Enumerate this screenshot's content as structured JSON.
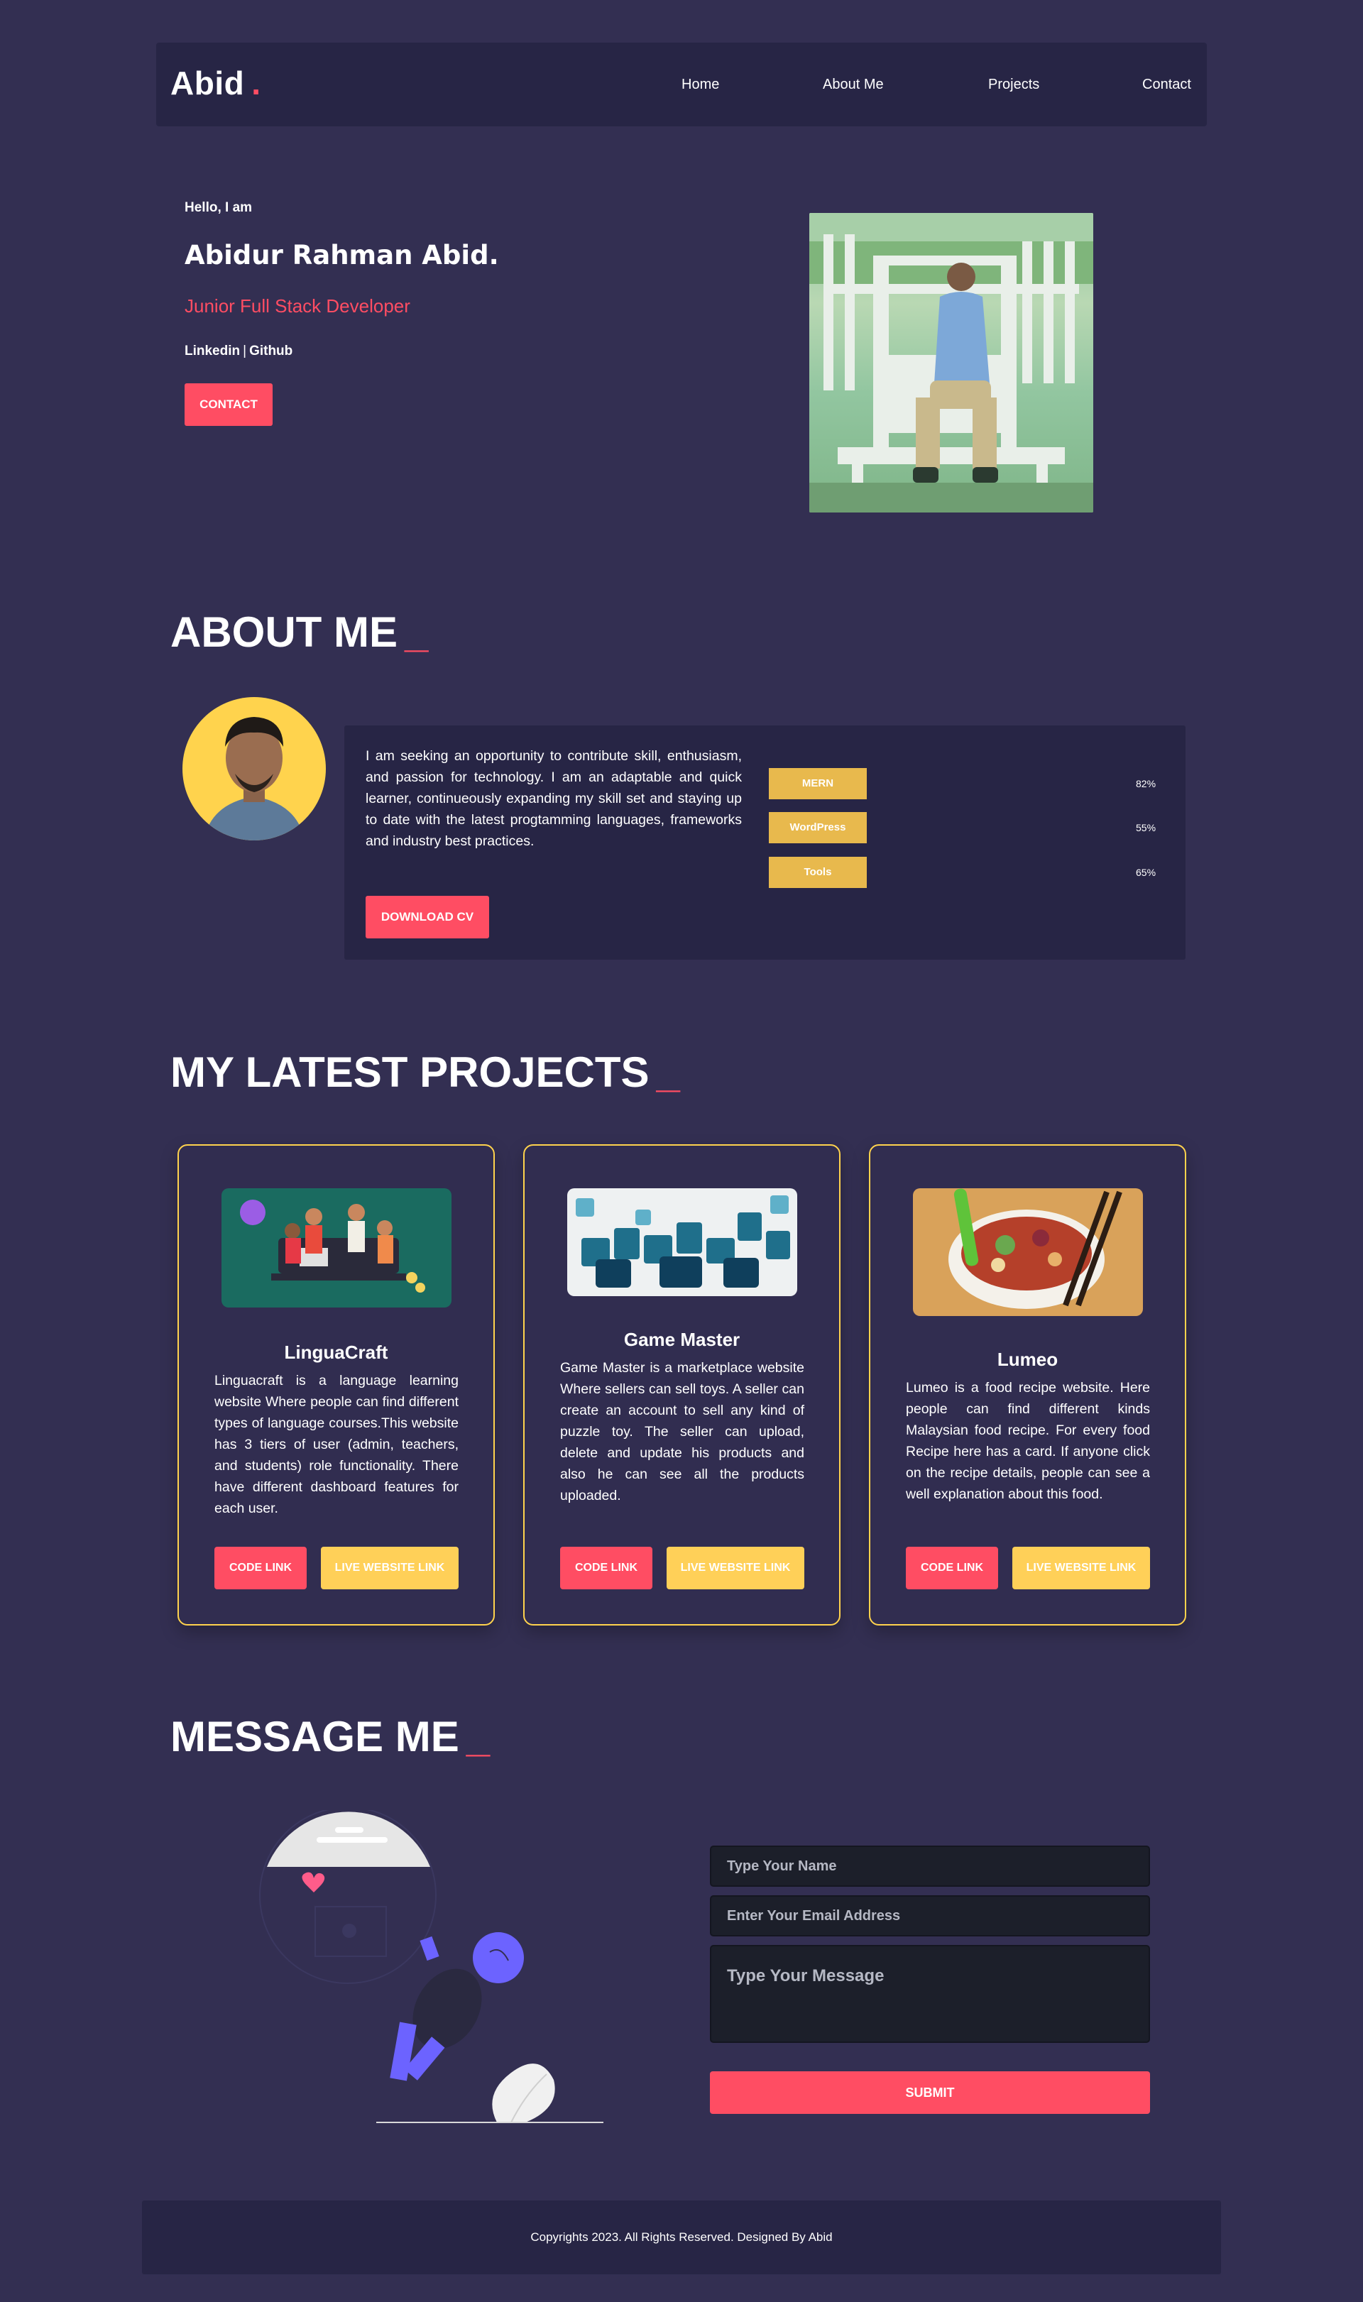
{
  "nav": {
    "logo": "Abid",
    "logo_dot": ".",
    "links": [
      "Home",
      "About Me",
      "Projects",
      "Contact"
    ]
  },
  "hero": {
    "greeting": "Hello, I am",
    "name": "Abidur Rahman Abid.",
    "role": "Junior Full Stack Developer",
    "linkedin": "Linkedin",
    "separator": "|",
    "github": "Github",
    "contact_button": "CONTACT"
  },
  "about": {
    "title": "ABOUT ME",
    "title_mark": "_",
    "text": "I am seeking an opportunity to contribute skill, enthusiasm, and passion for technology. I am an adaptable and quick learner, continueously expanding my skill set and staying up to date with the latest progtamming languages, frameworks and industry best practices.",
    "cv_button": "DOWNLOAD CV",
    "skills": [
      {
        "label": "MERN",
        "percent": "82%"
      },
      {
        "label": "WordPress",
        "percent": "55%"
      },
      {
        "label": "Tools",
        "percent": "65%"
      }
    ]
  },
  "projects": {
    "title": "MY LATEST PROJECTS",
    "title_mark": "_",
    "items": [
      {
        "title": "LinguaCraft",
        "description": "Linguacraft is a language learning website Where people can find different types of language courses.This website has 3 tiers of user (admin, teachers, and students) role functionality. There have different dashboard features for each user.",
        "code_button": "CODE LINK",
        "live_button": "LIVE WEBSITE LINK"
      },
      {
        "title": "Game Master",
        "description": "Game Master is a marketplace website Where sellers can sell toys. A seller can create an account to sell any kind of puzzle toy. The seller can upload, delete and update his products and also he can see all the products uploaded.",
        "code_button": "CODE LINK",
        "live_button": "LIVE WEBSITE LINK"
      },
      {
        "title": "Lumeo",
        "description": "Lumeo is a food recipe website. Here people can find different kinds Malaysian food recipe. For every food Recipe here has a card. If anyone click on the recipe details, people can see a well explanation about this food.",
        "code_button": "CODE LINK",
        "live_button": "LIVE WEBSITE LINK"
      }
    ]
  },
  "message": {
    "title": "MESSAGE ME",
    "title_mark": "_",
    "name_placeholder": "Type Your Name",
    "email_placeholder": "Enter Your Email Address",
    "message_placeholder": "Type Your Message",
    "submit_button": "SUBMIT"
  },
  "footer": {
    "text": "Copyrights 2023. All Rights Reserved. Designed By Abid"
  },
  "colors": {
    "background": "#332f52",
    "panel": "#272545",
    "accent_red": "#ff4d63",
    "accent_yellow": "#ffd34d"
  }
}
